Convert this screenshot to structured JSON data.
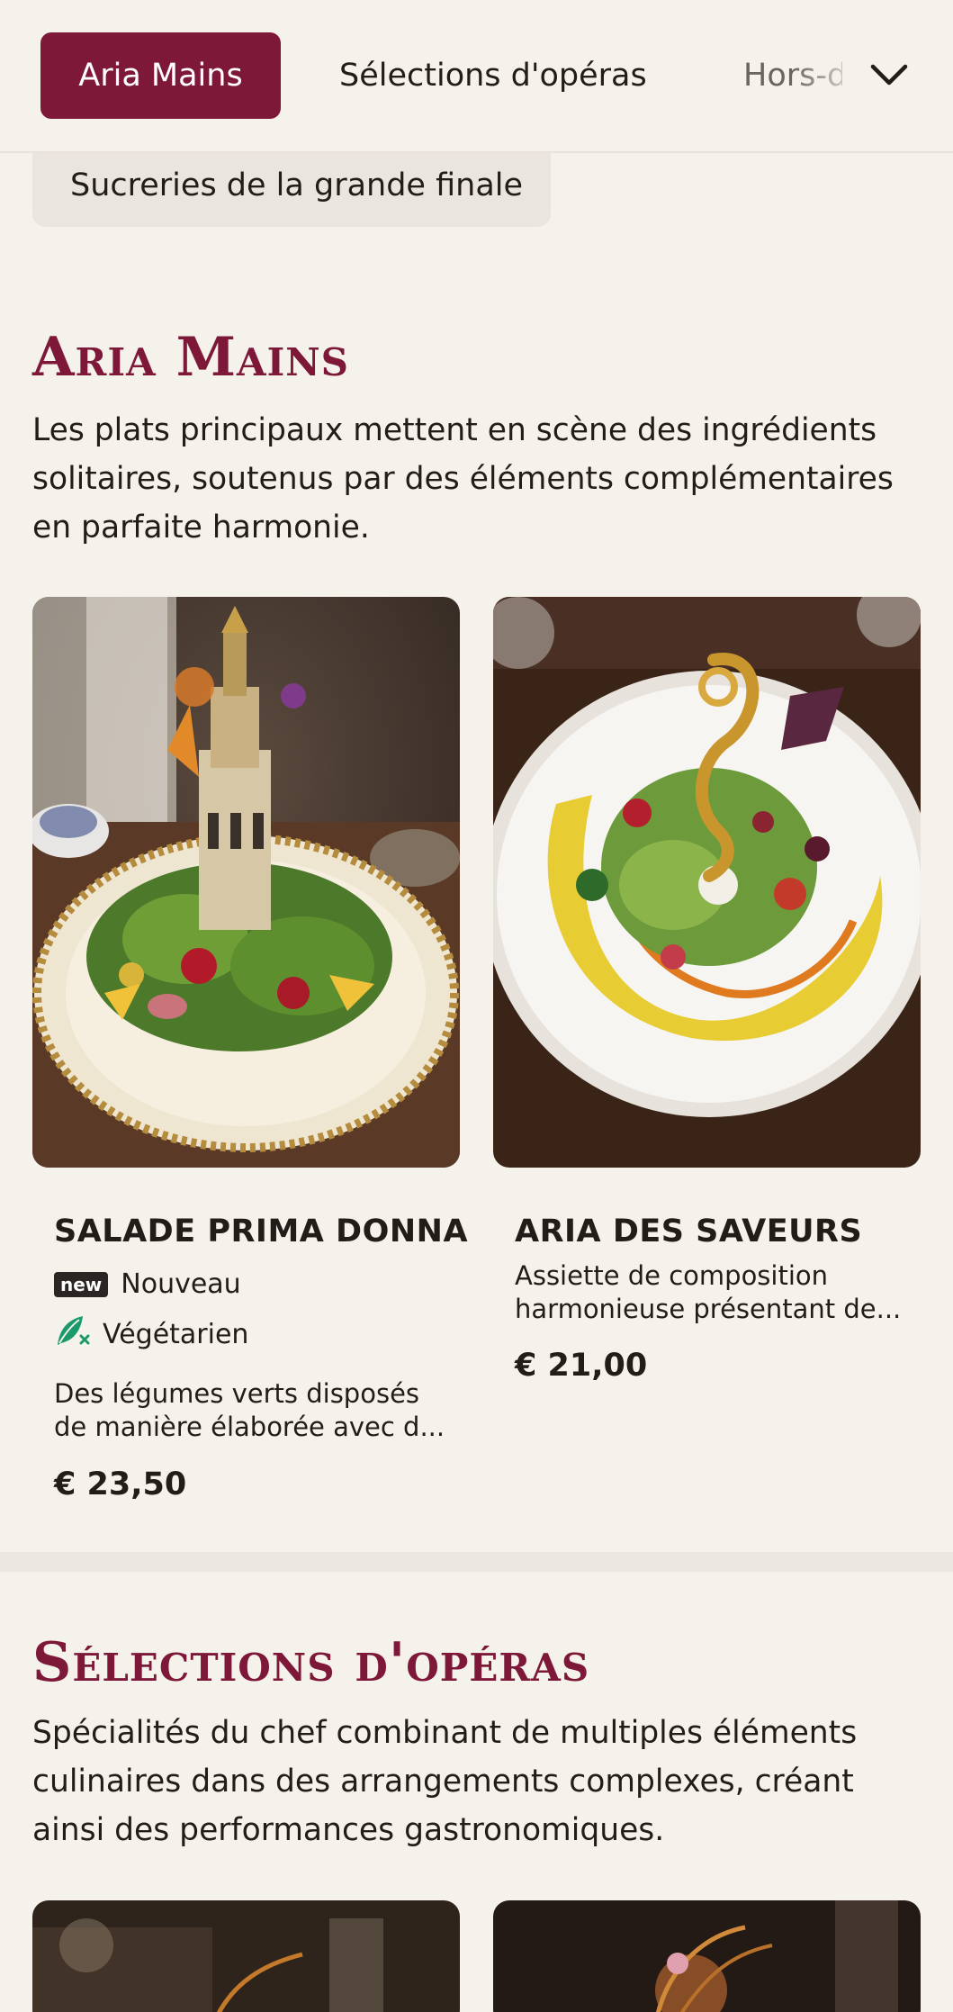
{
  "nav": {
    "tabs": [
      {
        "label": "Aria Mains",
        "active": true
      },
      {
        "label": "Sélections d'opéras",
        "active": false
      },
      {
        "label": "Hors-d'œuvre",
        "active": false
      }
    ],
    "more_icon": "chevron-down-icon"
  },
  "chip": {
    "label": "Sucreries de la grande finale"
  },
  "sections": [
    {
      "title": "Aria Mains",
      "description": "Les plats principaux mettent en scène des ingrédients solitaires, soutenus par des éléments complémentaires en parfaite harmonie.",
      "items": [
        {
          "name": "SALADE PRIMA DONNA",
          "badge": "new",
          "badge_label": "Nouveau",
          "diet_icon": "vegetarian-leaf-icon",
          "diet_label": "Végétarien",
          "description": "Des légumes verts disposés de manière élaborée avec d...",
          "price": "€ 23,50"
        },
        {
          "name": "ARIA DES SAVEURS",
          "description": "Assiette de composition harmonieuse présentant de...",
          "price": "€ 21,00"
        }
      ]
    },
    {
      "title": "Sélections d'opéras",
      "description": "Spécialités du chef combinant de multiples éléments culinaires dans des arrangements complexes, créant ainsi des performances gastronomiques."
    }
  ],
  "colors": {
    "accent": "#7d1839",
    "background": "#f5f1eb",
    "text": "#231d1a",
    "veg_green": "#1a9a6a"
  }
}
